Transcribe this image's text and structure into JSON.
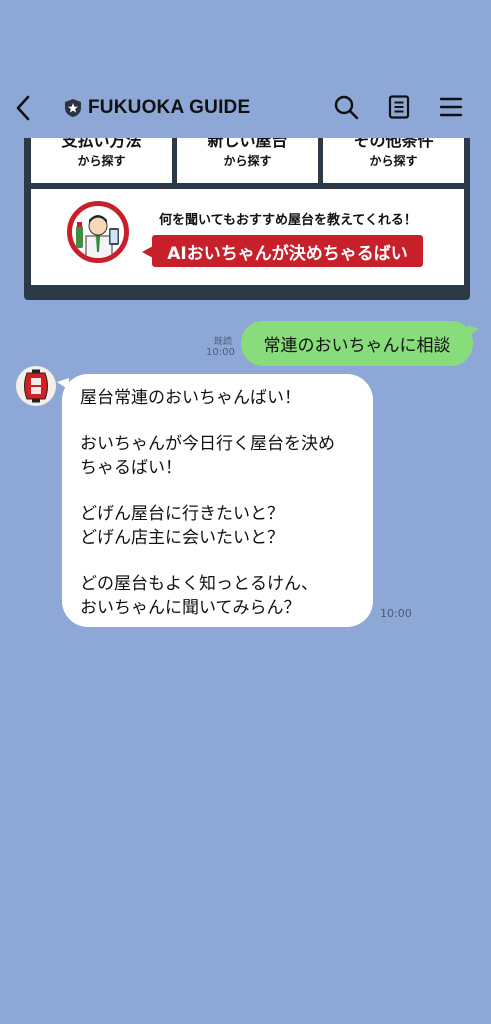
{
  "header": {
    "title": "FUKUOKA GUIDE",
    "back_icon": "chevron-left-icon",
    "badge_icon": "star-shield-icon",
    "search_icon": "search-icon",
    "notes_icon": "notes-icon",
    "menu_icon": "hamburger-menu-icon"
  },
  "rich_menu": {
    "buttons": [
      {
        "main": "支払い方法",
        "sub": "から探す"
      },
      {
        "main": "新しい屋台",
        "sub": "から探す"
      },
      {
        "main": "その他条件",
        "sub": "から探す"
      }
    ],
    "banner": {
      "text": "何を聞いてもおすすめ屋台を教えてくれる！",
      "pill": "AIおいちゃんが決めちゃるばい"
    }
  },
  "chat": {
    "outgoing": {
      "read": "既読",
      "time": "10:00",
      "text": "常連のおいちゃんに相談"
    },
    "incoming": {
      "lines": [
        "屋台常連のおいちゃんばい！",
        "おいちゃんが今日行く屋台を決め",
        "ちゃるばい！",
        "どげん屋台に行きたいと？",
        "どげん店主に会いたいと？",
        "どの屋台もよく知っとるけん、",
        "おいちゃんに聞いてみらん？"
      ],
      "time": "10:00"
    }
  },
  "colors": {
    "background": "#8da8d6",
    "outgoing_bubble": "#88dc7b",
    "incoming_bubble": "#ffffff",
    "accent_red": "#c8202a",
    "card_dark": "#2c3a48"
  }
}
